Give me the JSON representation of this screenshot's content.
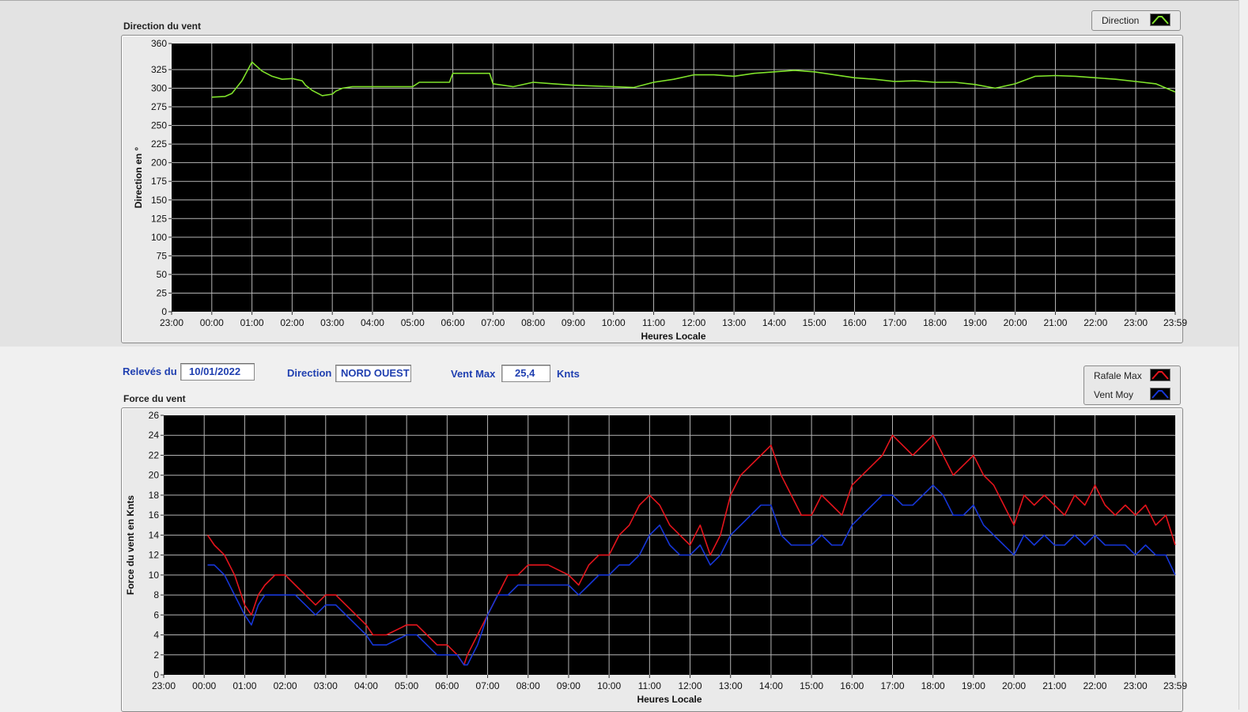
{
  "info": {
    "releves_label": "Relevés du",
    "releves_value": "10/01/2022",
    "direction_label": "Direction",
    "direction_value": "NORD OUEST",
    "ventmax_label": "Vent Max",
    "ventmax_value": "25,4",
    "ventmax_unit": "Knts"
  },
  "legends": {
    "top": [
      {
        "label": "Direction",
        "icon": "green-line-icon"
      }
    ],
    "bottom": [
      {
        "label": "Rafale Max",
        "icon": "red-line-icon"
      },
      {
        "label": "Vent Moy",
        "icon": "blue-line-icon"
      }
    ]
  },
  "colors": {
    "direction": "#7fe22a",
    "rafale": "#e4141c",
    "moy": "#1636d8",
    "plot_bg": "#000000",
    "grid": "#b4b4b4",
    "label_blue": "#1f3fb0"
  },
  "chart_data": [
    {
      "type": "line",
      "title": "Direction du vent",
      "xlabel": "Heures Locale",
      "ylabel": "Direction en °",
      "xlim": [
        "23:00",
        "23:59"
      ],
      "x_ticks": [
        "23:00",
        "00:00",
        "01:00",
        "02:00",
        "03:00",
        "04:00",
        "05:00",
        "06:00",
        "07:00",
        "08:00",
        "09:00",
        "10:00",
        "11:00",
        "12:00",
        "13:00",
        "14:00",
        "15:00",
        "16:00",
        "17:00",
        "18:00",
        "19:00",
        "20:00",
        "21:00",
        "22:00",
        "23:00",
        "23:59"
      ],
      "ylim": [
        0,
        360
      ],
      "y_ticks": [
        "0",
        "25",
        "50",
        "75",
        "100",
        "125",
        "150",
        "175",
        "200",
        "225",
        "250",
        "275",
        "300",
        "325",
        "360"
      ],
      "grid": true,
      "legend_position": "top-right",
      "series": [
        {
          "name": "Direction",
          "x": [
            "00:00",
            "00:20",
            "00:30",
            "00:45",
            "01:00",
            "01:15",
            "01:30",
            "01:45",
            "02:00",
            "02:15",
            "02:20",
            "02:30",
            "02:45",
            "03:00",
            "03:05",
            "03:15",
            "03:30",
            "04:00",
            "04:30",
            "05:00",
            "05:10",
            "05:30",
            "05:55",
            "06:00",
            "06:30",
            "06:55",
            "07:00",
            "07:30",
            "08:00",
            "08:30",
            "09:00",
            "09:30",
            "10:00",
            "10:30",
            "11:00",
            "11:30",
            "12:00",
            "12:30",
            "13:00",
            "13:30",
            "14:00",
            "14:30",
            "15:00",
            "15:30",
            "16:00",
            "16:30",
            "17:00",
            "17:30",
            "18:00",
            "18:30",
            "19:00",
            "19:30",
            "20:00",
            "20:30",
            "21:00",
            "21:30",
            "22:00",
            "22:30",
            "23:00",
            "23:30",
            "23:59"
          ],
          "values": [
            288,
            289,
            293,
            310,
            335,
            323,
            316,
            312,
            313,
            310,
            304,
            297,
            290,
            292,
            296,
            300,
            302,
            302,
            302,
            302,
            308,
            308,
            308,
            320,
            320,
            320,
            306,
            302,
            308,
            306,
            304,
            303,
            302,
            301,
            308,
            312,
            318,
            318,
            316,
            320,
            322,
            324,
            322,
            318,
            314,
            312,
            309,
            310,
            308,
            308,
            305,
            300,
            306,
            316,
            317,
            316,
            314,
            312,
            309,
            306,
            295
          ]
        }
      ]
    },
    {
      "type": "line",
      "title": "Force du vent",
      "xlabel": "Heures Locale",
      "ylabel": "Force du vent en Knts",
      "xlim": [
        "23:00",
        "23:59"
      ],
      "x_ticks": [
        "23:00",
        "00:00",
        "01:00",
        "02:00",
        "03:00",
        "04:00",
        "05:00",
        "06:00",
        "07:00",
        "08:00",
        "09:00",
        "10:00",
        "11:00",
        "12:00",
        "13:00",
        "14:00",
        "15:00",
        "16:00",
        "17:00",
        "18:00",
        "19:00",
        "20:00",
        "21:00",
        "22:00",
        "23:00",
        "23:59"
      ],
      "ylim": [
        0,
        26
      ],
      "y_ticks": [
        "0",
        "2",
        "4",
        "6",
        "8",
        "10",
        "12",
        "14",
        "16",
        "18",
        "20",
        "22",
        "24",
        "26"
      ],
      "grid": true,
      "legend_position": "top-right",
      "series": [
        {
          "name": "Rafale Max",
          "x": [
            "00:05",
            "00:15",
            "00:30",
            "00:45",
            "01:00",
            "01:10",
            "01:20",
            "01:30",
            "01:45",
            "02:00",
            "02:15",
            "02:30",
            "02:45",
            "03:00",
            "03:15",
            "03:30",
            "03:45",
            "04:00",
            "04:10",
            "04:30",
            "05:00",
            "05:15",
            "05:30",
            "05:45",
            "06:00",
            "06:15",
            "06:25",
            "06:30",
            "06:45",
            "07:00",
            "07:15",
            "07:30",
            "07:45",
            "08:00",
            "08:30",
            "09:00",
            "09:15",
            "09:30",
            "09:45",
            "10:00",
            "10:15",
            "10:30",
            "10:45",
            "11:00",
            "11:15",
            "11:30",
            "11:45",
            "12:00",
            "12:15",
            "12:30",
            "12:45",
            "13:00",
            "13:15",
            "13:30",
            "13:45",
            "14:00",
            "14:15",
            "14:30",
            "14:45",
            "15:00",
            "15:15",
            "15:30",
            "15:45",
            "16:00",
            "16:15",
            "16:30",
            "16:45",
            "17:00",
            "17:15",
            "17:30",
            "17:45",
            "18:00",
            "18:15",
            "18:30",
            "18:45",
            "19:00",
            "19:15",
            "19:30",
            "19:45",
            "20:00",
            "20:15",
            "20:30",
            "20:45",
            "21:00",
            "21:15",
            "21:30",
            "21:45",
            "22:00",
            "22:15",
            "22:30",
            "22:45",
            "23:00",
            "23:15",
            "23:30",
            "23:45",
            "23:59"
          ],
          "values": [
            14,
            13,
            12,
            10,
            7,
            6,
            8,
            9,
            10,
            10,
            9,
            8,
            7,
            8,
            8,
            7,
            6,
            5,
            4,
            4,
            5,
            5,
            4,
            3,
            3,
            2,
            1,
            2,
            4,
            6,
            8,
            10,
            10,
            11,
            11,
            10,
            9,
            11,
            12,
            12,
            14,
            15,
            17,
            18,
            17,
            15,
            14,
            13,
            15,
            12,
            14,
            18,
            20,
            21,
            22,
            23,
            20,
            18,
            16,
            16,
            18,
            17,
            16,
            19,
            20,
            21,
            22,
            24,
            23,
            22,
            23,
            24,
            22,
            20,
            21,
            22,
            20,
            19,
            17,
            15,
            18,
            17,
            18,
            17,
            16,
            18,
            17,
            19,
            17,
            16,
            17,
            16,
            17,
            15,
            16,
            13
          ]
        },
        {
          "name": "Vent Moy",
          "x": [
            "00:05",
            "00:15",
            "00:30",
            "00:45",
            "01:00",
            "01:10",
            "01:20",
            "01:30",
            "01:45",
            "02:00",
            "02:15",
            "02:30",
            "02:45",
            "03:00",
            "03:15",
            "03:30",
            "03:45",
            "04:00",
            "04:10",
            "04:30",
            "05:00",
            "05:15",
            "05:30",
            "05:45",
            "06:00",
            "06:15",
            "06:25",
            "06:30",
            "06:45",
            "07:00",
            "07:15",
            "07:30",
            "07:45",
            "08:00",
            "08:30",
            "09:00",
            "09:15",
            "09:30",
            "09:45",
            "10:00",
            "10:15",
            "10:30",
            "10:45",
            "11:00",
            "11:15",
            "11:30",
            "11:45",
            "12:00",
            "12:15",
            "12:30",
            "12:45",
            "13:00",
            "13:15",
            "13:30",
            "13:45",
            "14:00",
            "14:15",
            "14:30",
            "14:45",
            "15:00",
            "15:15",
            "15:30",
            "15:45",
            "16:00",
            "16:15",
            "16:30",
            "16:45",
            "17:00",
            "17:15",
            "17:30",
            "17:45",
            "18:00",
            "18:15",
            "18:30",
            "18:45",
            "19:00",
            "19:15",
            "19:30",
            "19:45",
            "20:00",
            "20:15",
            "20:30",
            "20:45",
            "21:00",
            "21:15",
            "21:30",
            "21:45",
            "22:00",
            "22:15",
            "22:30",
            "22:45",
            "23:00",
            "23:15",
            "23:30",
            "23:45",
            "23:59"
          ],
          "values": [
            11,
            11,
            10,
            8,
            6,
            5,
            7,
            8,
            8,
            8,
            8,
            7,
            6,
            7,
            7,
            6,
            5,
            4,
            3,
            3,
            4,
            4,
            3,
            2,
            2,
            2,
            1,
            1,
            3,
            6,
            8,
            8,
            9,
            9,
            9,
            9,
            8,
            9,
            10,
            10,
            11,
            11,
            12,
            14,
            15,
            13,
            12,
            12,
            13,
            11,
            12,
            14,
            15,
            16,
            17,
            17,
            14,
            13,
            13,
            13,
            14,
            13,
            13,
            15,
            16,
            17,
            18,
            18,
            17,
            17,
            18,
            19,
            18,
            16,
            16,
            17,
            15,
            14,
            13,
            12,
            14,
            13,
            14,
            13,
            13,
            14,
            13,
            14,
            13,
            13,
            13,
            12,
            13,
            12,
            12,
            10
          ]
        }
      ]
    }
  ]
}
